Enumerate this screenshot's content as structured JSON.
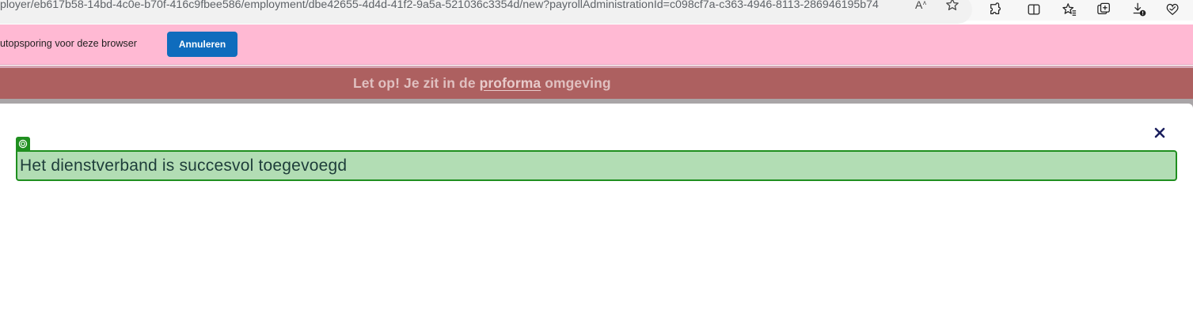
{
  "browser": {
    "url": "ployer/eb617b58-14bd-4c0e-b70f-416c9fbee586/employment/dbe42655-4d4d-41f2-9a5a-521036c3354d/new?payrollAdministrationId=c098cf7a-c363-4946-8113-286946195b74",
    "address_actions": [
      "read-aloud-icon",
      "favorite-star-icon"
    ],
    "toolbar_icons": [
      "extensions-icon",
      "split-screen-icon",
      "favorites-icon",
      "collections-icon",
      "downloads-icon",
      "browser-essentials-icon"
    ]
  },
  "infobar": {
    "text": "utopsporing voor deze browser",
    "cancel_label": "Annuleren"
  },
  "environment_banner": {
    "prefix": "Let op! Je zit in de ",
    "link": "proforma",
    "suffix": " omgeving"
  },
  "modal": {
    "close_icon": "close-icon",
    "alert": {
      "message": "Het dienstverband is succesvol toegevoegd",
      "badge_icon": "success-target-icon"
    }
  },
  "colors": {
    "infobar_bg": "#ffb9d3",
    "primary_button": "#0f6cbd",
    "banner_bg": "#ad6060",
    "success_bg": "#b2ddb4",
    "success_border": "#1f8f1f",
    "close_icon": "#1b1f5e"
  }
}
